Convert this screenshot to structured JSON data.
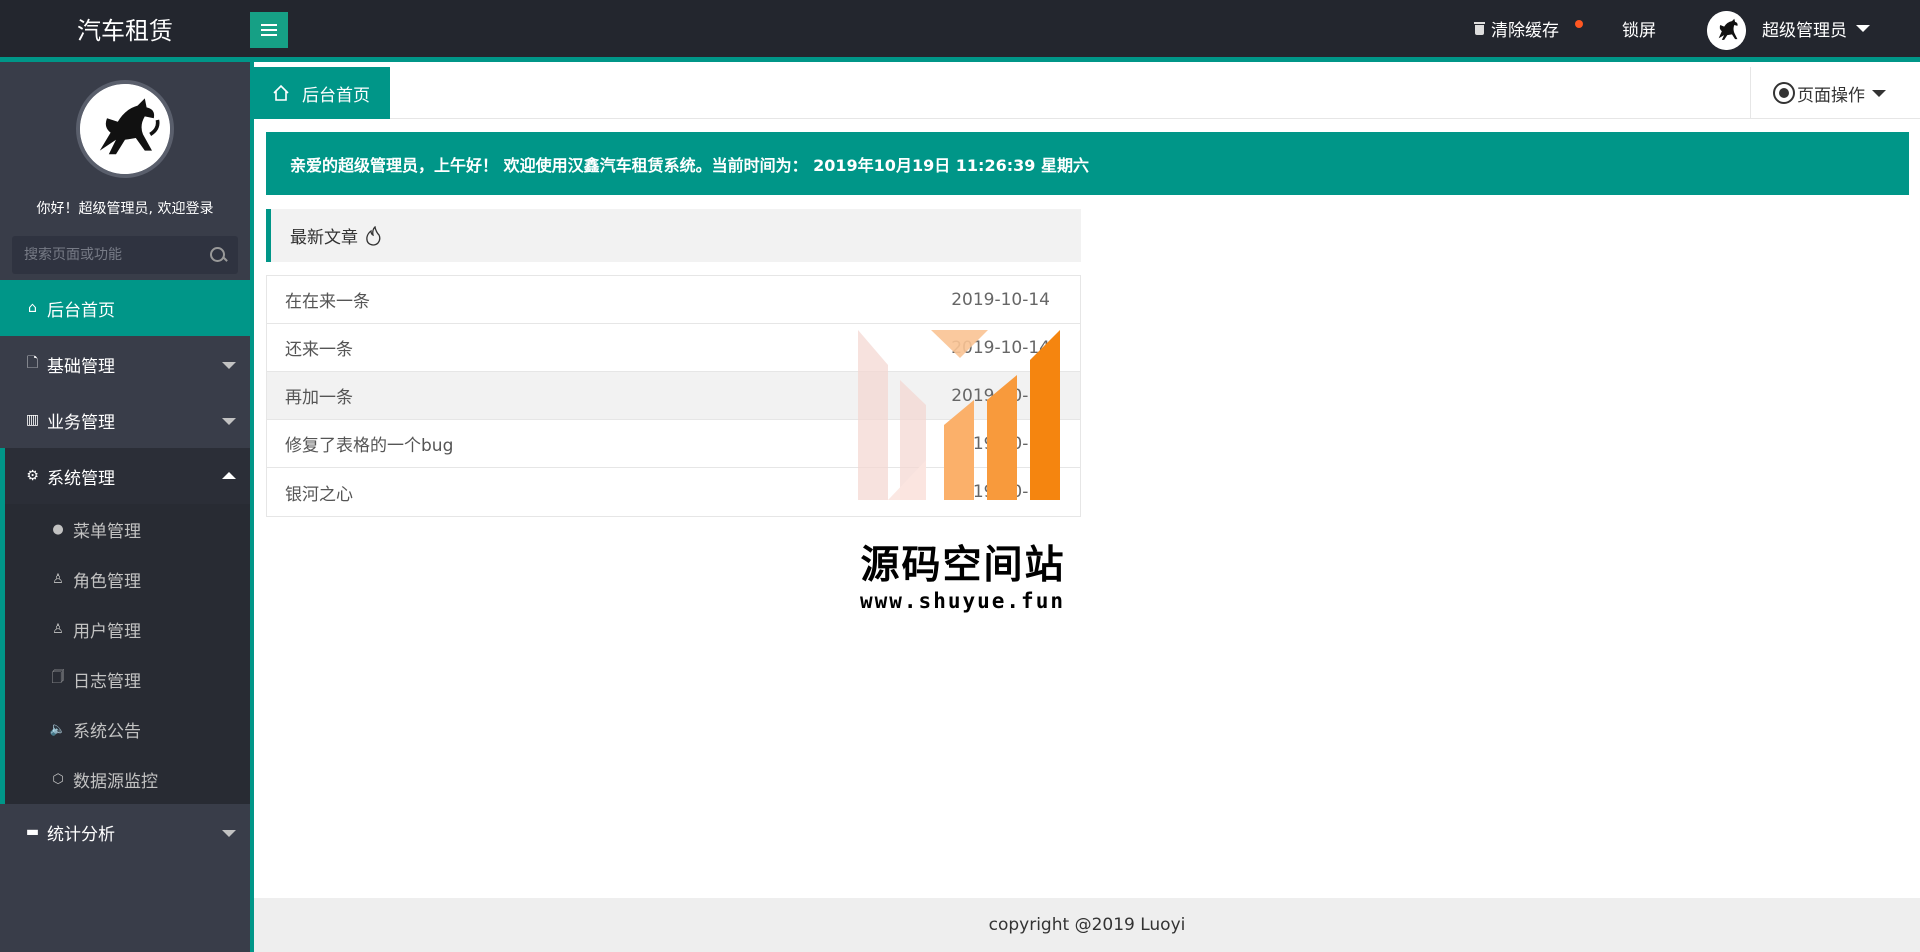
{
  "header": {
    "logo_text": "汽车租赁",
    "clear_cache": "清除缓存",
    "lock": "锁屏",
    "user_name": "超级管理员"
  },
  "sidebar": {
    "welcome": "你好！超级管理员, 欢迎登录",
    "search_placeholder": "搜索页面或功能",
    "items": [
      {
        "label": "后台首页",
        "icon": "home-icon"
      },
      {
        "label": "基础管理",
        "icon": "file-icon"
      },
      {
        "label": "业务管理",
        "icon": "book-icon"
      },
      {
        "label": "系统管理",
        "icon": "gear-icon"
      },
      {
        "label": "统计分析",
        "icon": "chart-icon"
      }
    ],
    "sub_items": [
      {
        "label": "菜单管理",
        "icon": "circle-icon"
      },
      {
        "label": "角色管理",
        "icon": "user-icon"
      },
      {
        "label": "用户管理",
        "icon": "users-icon"
      },
      {
        "label": "日志管理",
        "icon": "note-icon"
      },
      {
        "label": "系统公告",
        "icon": "speaker-icon"
      },
      {
        "label": "数据源监控",
        "icon": "cube-icon"
      }
    ]
  },
  "tabs": {
    "home": "后台首页",
    "page_ops": "页面操作"
  },
  "welcome_bar": {
    "text": "亲爱的超级管理员，上午好！ 欢迎使用汉鑫汽车租赁系统。当前时间为： 2019年10月19日 11:26:39 星期六"
  },
  "articles": {
    "title": "最新文章",
    "rows": [
      {
        "title": "在在来一条",
        "date": "2019-10-14"
      },
      {
        "title": "还来一条",
        "date": "2019-10-14"
      },
      {
        "title": "再加一条",
        "date": "2019-10-14"
      },
      {
        "title": "修复了表格的一个bug",
        "date": "2019-10-14"
      },
      {
        "title": "银河之心",
        "date": "2019-10-14"
      }
    ]
  },
  "watermark": {
    "text": "源码空间站",
    "url": "www.shuyue.fun"
  },
  "footer": {
    "text": "copyright @2019 Luoyi"
  },
  "colors": {
    "accent": "#009688",
    "header_bg": "#23262e",
    "sidebar_bg": "#393d49",
    "badge": "#ff5722"
  }
}
